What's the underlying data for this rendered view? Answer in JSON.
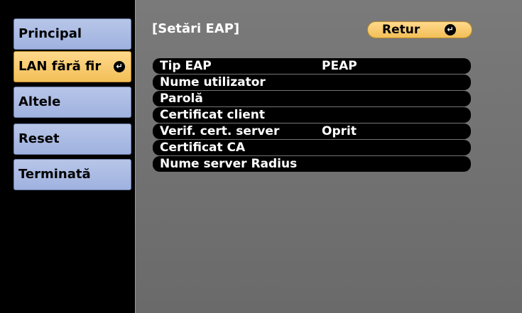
{
  "menu": [
    {
      "label": "Principal",
      "active": false
    },
    {
      "label": "LAN fără fir",
      "active": true,
      "icon": "enter-icon"
    },
    {
      "label": "Altele",
      "active": false
    },
    {
      "label": "Reset",
      "active": false
    },
    {
      "label": "Terminată",
      "active": false
    }
  ],
  "panel": {
    "title": "[Setări EAP]",
    "return_button": "Retur",
    "rows": [
      {
        "label": "Tip EAP",
        "value": "PEAP"
      },
      {
        "label": "Nume utilizator",
        "value": ""
      },
      {
        "label": "Parolă",
        "value": ""
      },
      {
        "label": "Certificat client",
        "value": ""
      },
      {
        "label": "Verif. cert. server",
        "value": "Oprit"
      },
      {
        "label": "Certificat CA",
        "value": ""
      },
      {
        "label": "Nume server Radius",
        "value": ""
      }
    ]
  },
  "colors": {
    "menu_inactive": "#b7c5e8",
    "menu_active": "#f2bf57",
    "panel_bg": "#727272",
    "row_bg": "#000000"
  }
}
